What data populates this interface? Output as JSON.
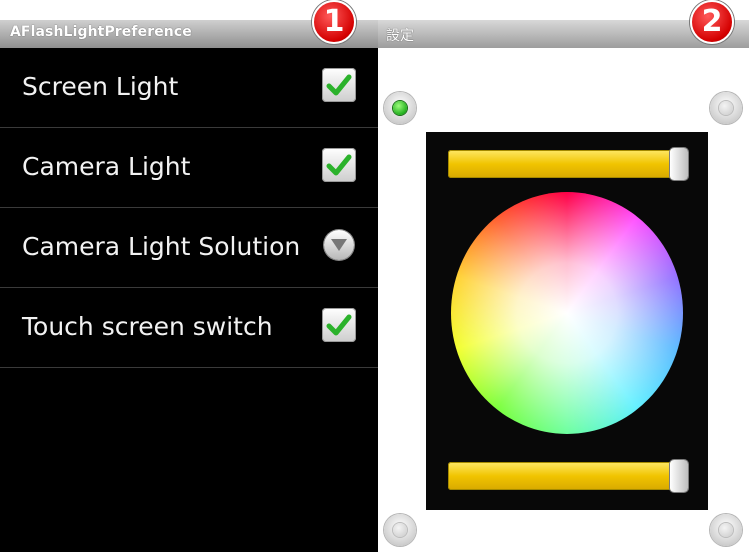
{
  "left_panel": {
    "title": "AFlashLightPreference",
    "preferences": [
      {
        "label": "Screen Light",
        "control": "checkbox",
        "checked": true
      },
      {
        "label": "Camera Light",
        "control": "checkbox",
        "checked": true
      },
      {
        "label": "Camera Light Solution",
        "control": "dropdown"
      },
      {
        "label": "Touch screen switch",
        "control": "checkbox",
        "checked": true
      }
    ]
  },
  "right_panel": {
    "title": "設定",
    "corner_buttons": {
      "top_left": {
        "active": true,
        "color": "#22b01e"
      },
      "top_right": {
        "active": false
      },
      "bottom_left": {
        "active": false
      },
      "bottom_right": {
        "active": false
      }
    },
    "top_slider": {
      "value": 1.0,
      "color": "#f1c400"
    },
    "bottom_slider": {
      "value": 1.0,
      "color": "#f1c400"
    }
  },
  "callouts": [
    "1",
    "2"
  ],
  "colors": {
    "checkmark": "#2bb22b",
    "badge": "#d40000"
  }
}
